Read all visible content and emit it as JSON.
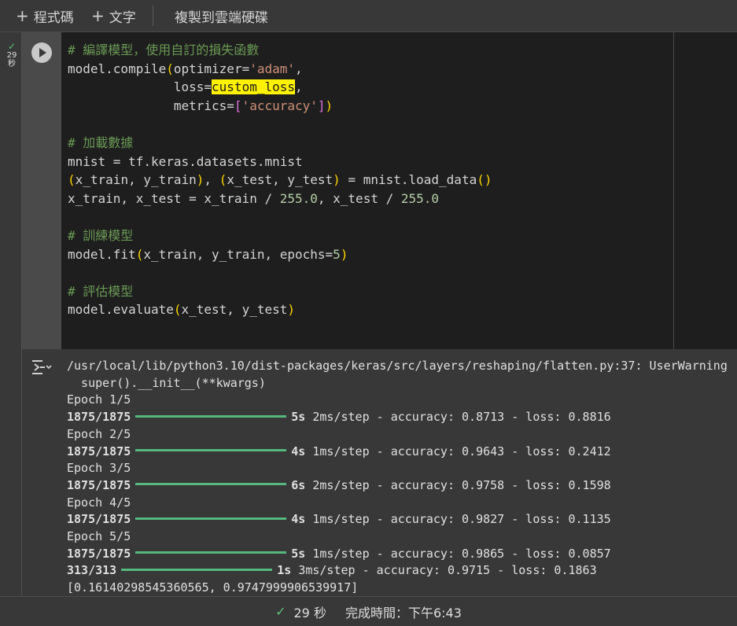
{
  "toolbar": {
    "add_code_label": "程式碼",
    "add_text_label": "文字",
    "copy_to_drive_label": "複製到雲端硬碟"
  },
  "cell": {
    "exec_time": "29",
    "exec_time_unit": "秒",
    "code_lines": {
      "l1": "# 編譯模型，使用自訂的損失函數",
      "l2_a": "model.compile",
      "l2_b": "(",
      "l2_c": "optimizer=",
      "l2_d": "'adam'",
      "l2_e": ",",
      "l3_a": "              loss=",
      "l3_b": "custom_loss",
      "l3_c": ",",
      "l4_a": "              metrics=",
      "l4_b": "[",
      "l4_c": "'accuracy'",
      "l4_d": "]",
      "l4_e": ")",
      "l6": "# 加載數據",
      "l7": "mnist = tf.keras.datasets.mnist",
      "l8_a": "(",
      "l8_b": "x_train, y_train",
      "l8_c": ")",
      "l8_d": ", ",
      "l8_e": "(",
      "l8_f": "x_test, y_test",
      "l8_g": ")",
      "l8_h": " = mnist.load_data",
      "l8_i": "()",
      "l9_a": "x_train, x_test = x_train / ",
      "l9_b": "255.0",
      "l9_c": ", x_test / ",
      "l9_d": "255.0",
      "l11": "# 訓練模型",
      "l12_a": "model.fit",
      "l12_b": "(",
      "l12_c": "x_train, y_train, epochs=",
      "l12_d": "5",
      "l12_e": ")",
      "l14": "# 評估模型",
      "l15_a": "model.evaluate",
      "l15_b": "(",
      "l15_c": "x_test, y_test",
      "l15_d": ")"
    }
  },
  "output": {
    "warning_line": "/usr/local/lib/python3.10/dist-packages/keras/src/layers/reshaping/flatten.py:37: UserWarning",
    "warning_line2": "  super().__init__(**kwargs)",
    "epochs": [
      {
        "label": "Epoch 1/5",
        "steps": "1875/1875",
        "time": "5s",
        "rest": "2ms/step - accuracy: 0.8713 - loss: 0.8816"
      },
      {
        "label": "Epoch 2/5",
        "steps": "1875/1875",
        "time": "4s",
        "rest": "1ms/step - accuracy: 0.9643 - loss: 0.2412"
      },
      {
        "label": "Epoch 3/5",
        "steps": "1875/1875",
        "time": "6s",
        "rest": "2ms/step - accuracy: 0.9758 - loss: 0.1598"
      },
      {
        "label": "Epoch 4/5",
        "steps": "1875/1875",
        "time": "4s",
        "rest": "1ms/step - accuracy: 0.9827 - loss: 0.1135"
      },
      {
        "label": "Epoch 5/5",
        "steps": "1875/1875",
        "time": "5s",
        "rest": "1ms/step - accuracy: 0.9865 - loss: 0.0857"
      }
    ],
    "eval": {
      "steps": "313/313",
      "time": "1s",
      "rest": "3ms/step - accuracy: 0.9715 - loss: 0.1863"
    },
    "result": "[0.16140298545360565, 0.9747999906539917]",
    "progress_color": "#56b77f"
  },
  "statusbar": {
    "duration": "29 秒",
    "completed_label": "完成時間：下午6:43"
  }
}
